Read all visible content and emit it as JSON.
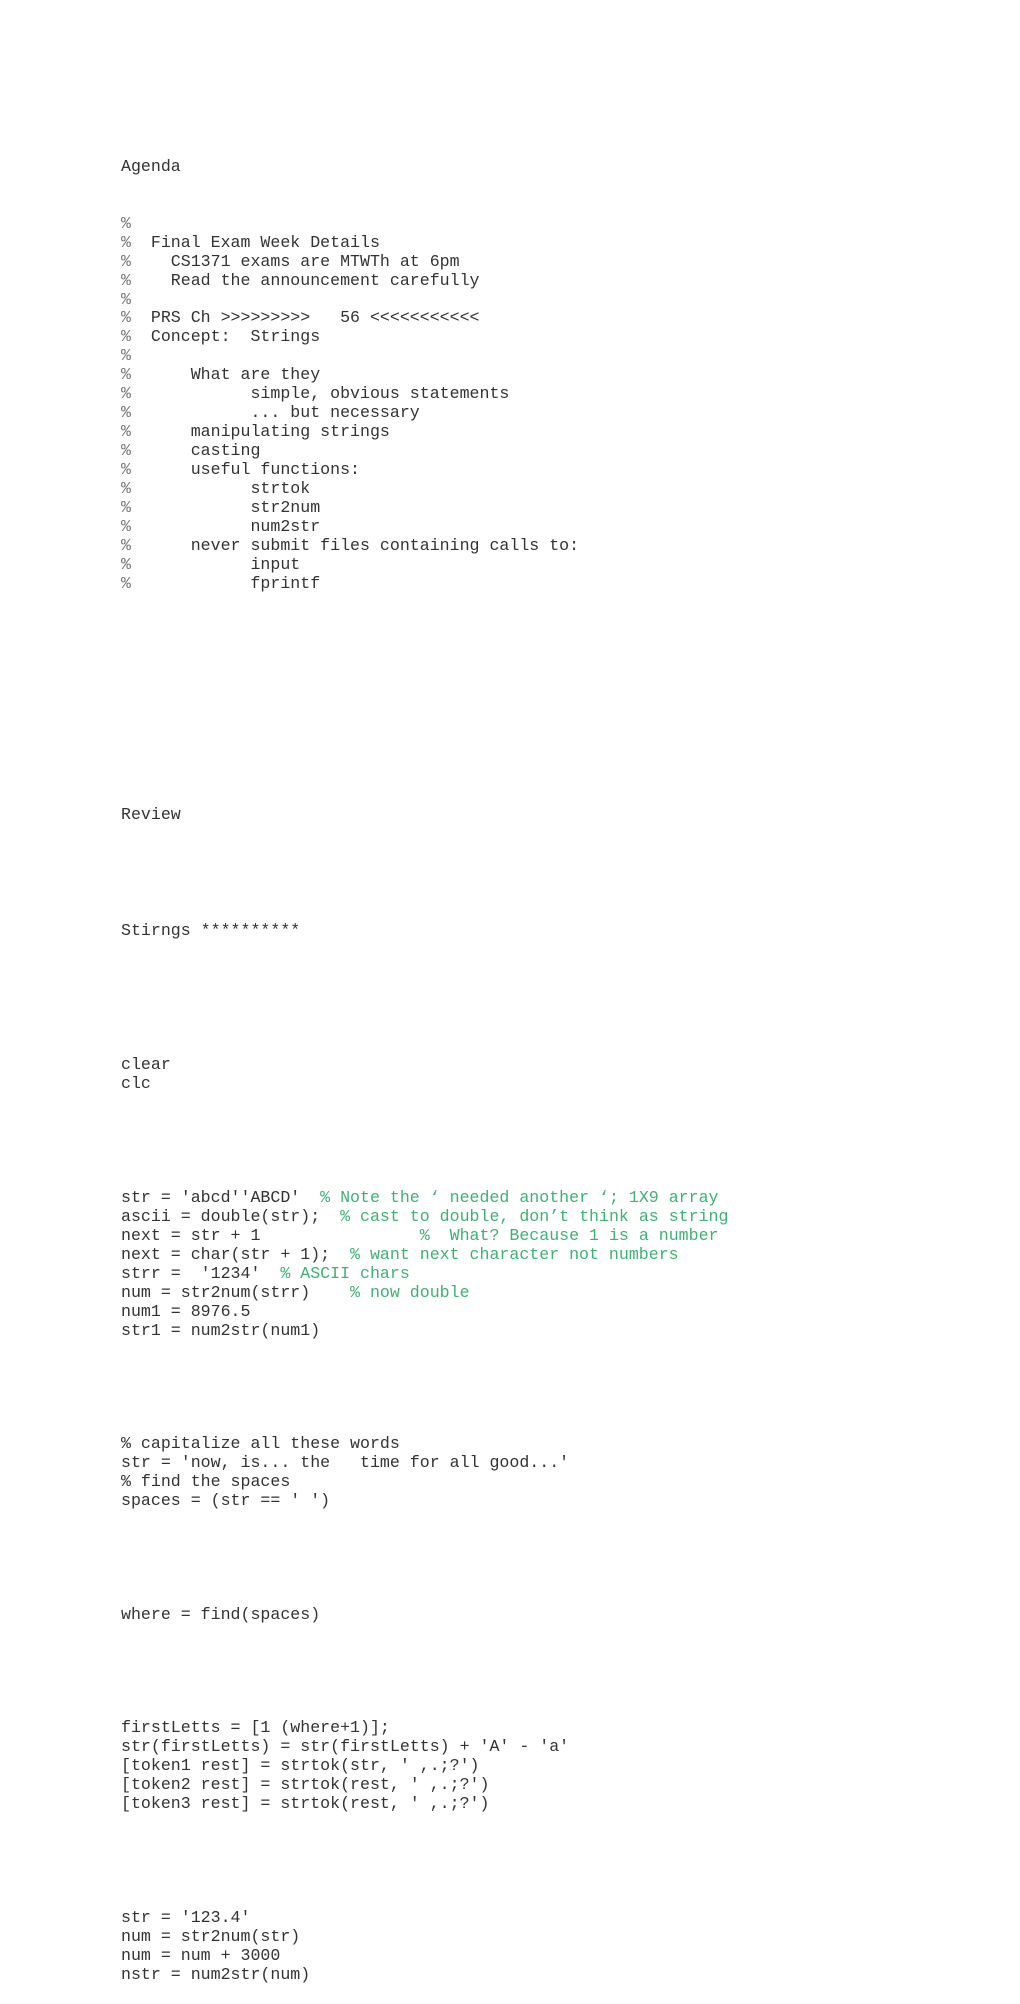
{
  "agenda": {
    "title": "Agenda",
    "lines": [
      {
        "pct": "%",
        "text": ""
      },
      {
        "pct": "%",
        "text": "  Final Exam Week Details"
      },
      {
        "pct": "%",
        "text": "    CS1371 exams are MTWTh at 6pm"
      },
      {
        "pct": "%",
        "text": "    Read the announcement carefully"
      },
      {
        "pct": "%",
        "text": ""
      },
      {
        "pct": "%",
        "text": "  PRS Ch >>>>>>>>>   56 <<<<<<<<<<<"
      },
      {
        "pct": "%",
        "text": "  Concept:  Strings"
      },
      {
        "pct": "%",
        "text": ""
      },
      {
        "pct": "%",
        "text": "      What are they"
      },
      {
        "pct": "%",
        "text": "            simple, obvious statements"
      },
      {
        "pct": "%",
        "text": "            ... but necessary"
      },
      {
        "pct": "%",
        "text": "      manipulating strings"
      },
      {
        "pct": "%",
        "text": "      casting"
      },
      {
        "pct": "%",
        "text": "      useful functions:"
      },
      {
        "pct": "%",
        "text": "            strtok"
      },
      {
        "pct": "%",
        "text": "            str2num"
      },
      {
        "pct": "%",
        "text": "            num2str"
      },
      {
        "pct": "%",
        "text": "      never submit files containing calls to:"
      },
      {
        "pct": "%",
        "text": "            input"
      },
      {
        "pct": "%",
        "text": "            fprintf"
      }
    ]
  },
  "review": {
    "title": "Review",
    "subtitle": "Stirngs **********"
  },
  "code": {
    "block1": [
      "clear",
      "clc"
    ],
    "block2": [
      {
        "code": "str = 'abcd''ABCD'  ",
        "comment": "% Note the ‘ needed another ‘; 1X9 array"
      },
      {
        "code": "ascii = double(str);  ",
        "comment": "% cast to double, don’t think as string"
      },
      {
        "code": "next = str + 1                ",
        "comment": "%  What? Because 1 is a number"
      },
      {
        "code": "next = char(str + 1);  ",
        "comment": "% want next character not numbers"
      },
      {
        "code": "strr =  '1234'  ",
        "comment": "% ASCII chars"
      },
      {
        "code": "num = str2num(strr)    ",
        "comment": "% now double"
      },
      {
        "code": "num1 = 8976.5",
        "comment": ""
      },
      {
        "code": "str1 = num2str(num1)",
        "comment": ""
      }
    ],
    "block3": [
      "% capitalize all these words",
      "str = 'now, is... the   time for all good...'",
      "% find the spaces",
      "spaces = (str == ' ')"
    ],
    "block4": [
      "where = find(spaces)"
    ],
    "block5": [
      "firstLetts = [1 (where+1)];",
      "str(firstLetts) = str(firstLetts) + 'A' - 'a'",
      "[token1 rest] = strtok(str, ' ,.;?')",
      "[token2 rest] = strtok(rest, ' ,.;?')",
      "[token3 rest] = strtok(rest, ' ,.;?')"
    ],
    "block6": [
      "str = '123.4'",
      "num = str2num(str)",
      "num = num + 3000",
      "nstr = num2str(num)"
    ]
  },
  "colors": {
    "text": "#333333",
    "comment": "#3cb371"
  }
}
